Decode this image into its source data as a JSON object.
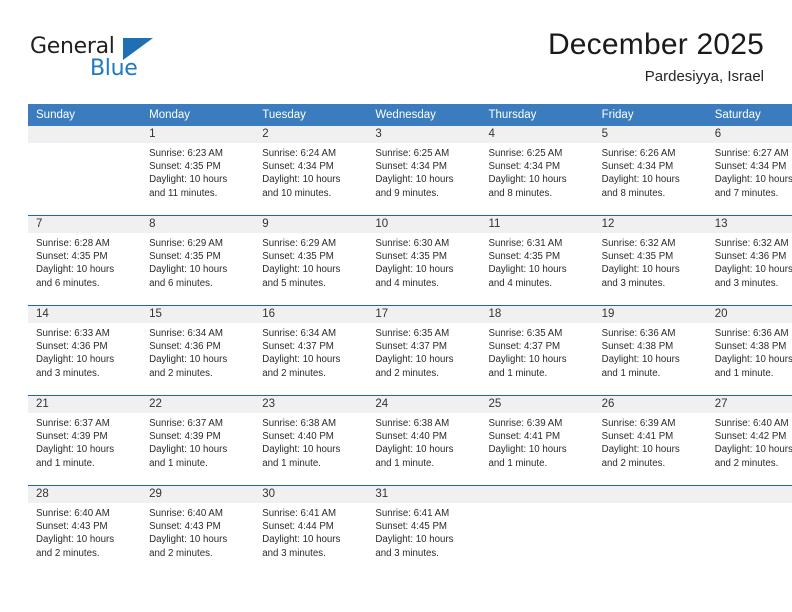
{
  "logo": {
    "text_top": "General",
    "text_bottom": "Blue"
  },
  "header": {
    "title": "December 2025",
    "location": "Pardesiyya, Israel"
  },
  "colors": {
    "header_blue": "#3a7cbe",
    "row_divider_blue": "#1c68ab",
    "daynum_band": "#f0f0f0",
    "logo_blue": "#1f7ac0"
  },
  "weekday_headers": [
    "Sunday",
    "Monday",
    "Tuesday",
    "Wednesday",
    "Thursday",
    "Friday",
    "Saturday"
  ],
  "weeks": [
    [
      {
        "day": "",
        "blank": true,
        "sunrise": "",
        "sunset": "",
        "daylight1": "",
        "daylight2": ""
      },
      {
        "day": "1",
        "sunrise": "Sunrise: 6:23 AM",
        "sunset": "Sunset: 4:35 PM",
        "daylight1": "Daylight: 10 hours",
        "daylight2": "and 11 minutes."
      },
      {
        "day": "2",
        "sunrise": "Sunrise: 6:24 AM",
        "sunset": "Sunset: 4:34 PM",
        "daylight1": "Daylight: 10 hours",
        "daylight2": "and 10 minutes."
      },
      {
        "day": "3",
        "sunrise": "Sunrise: 6:25 AM",
        "sunset": "Sunset: 4:34 PM",
        "daylight1": "Daylight: 10 hours",
        "daylight2": "and 9 minutes."
      },
      {
        "day": "4",
        "sunrise": "Sunrise: 6:25 AM",
        "sunset": "Sunset: 4:34 PM",
        "daylight1": "Daylight: 10 hours",
        "daylight2": "and 8 minutes."
      },
      {
        "day": "5",
        "sunrise": "Sunrise: 6:26 AM",
        "sunset": "Sunset: 4:34 PM",
        "daylight1": "Daylight: 10 hours",
        "daylight2": "and 8 minutes."
      },
      {
        "day": "6",
        "sunrise": "Sunrise: 6:27 AM",
        "sunset": "Sunset: 4:34 PM",
        "daylight1": "Daylight: 10 hours",
        "daylight2": "and 7 minutes."
      }
    ],
    [
      {
        "day": "7",
        "sunrise": "Sunrise: 6:28 AM",
        "sunset": "Sunset: 4:35 PM",
        "daylight1": "Daylight: 10 hours",
        "daylight2": "and 6 minutes."
      },
      {
        "day": "8",
        "sunrise": "Sunrise: 6:29 AM",
        "sunset": "Sunset: 4:35 PM",
        "daylight1": "Daylight: 10 hours",
        "daylight2": "and 6 minutes."
      },
      {
        "day": "9",
        "sunrise": "Sunrise: 6:29 AM",
        "sunset": "Sunset: 4:35 PM",
        "daylight1": "Daylight: 10 hours",
        "daylight2": "and 5 minutes."
      },
      {
        "day": "10",
        "sunrise": "Sunrise: 6:30 AM",
        "sunset": "Sunset: 4:35 PM",
        "daylight1": "Daylight: 10 hours",
        "daylight2": "and 4 minutes."
      },
      {
        "day": "11",
        "sunrise": "Sunrise: 6:31 AM",
        "sunset": "Sunset: 4:35 PM",
        "daylight1": "Daylight: 10 hours",
        "daylight2": "and 4 minutes."
      },
      {
        "day": "12",
        "sunrise": "Sunrise: 6:32 AM",
        "sunset": "Sunset: 4:35 PM",
        "daylight1": "Daylight: 10 hours",
        "daylight2": "and 3 minutes."
      },
      {
        "day": "13",
        "sunrise": "Sunrise: 6:32 AM",
        "sunset": "Sunset: 4:36 PM",
        "daylight1": "Daylight: 10 hours",
        "daylight2": "and 3 minutes."
      }
    ],
    [
      {
        "day": "14",
        "sunrise": "Sunrise: 6:33 AM",
        "sunset": "Sunset: 4:36 PM",
        "daylight1": "Daylight: 10 hours",
        "daylight2": "and 3 minutes."
      },
      {
        "day": "15",
        "sunrise": "Sunrise: 6:34 AM",
        "sunset": "Sunset: 4:36 PM",
        "daylight1": "Daylight: 10 hours",
        "daylight2": "and 2 minutes."
      },
      {
        "day": "16",
        "sunrise": "Sunrise: 6:34 AM",
        "sunset": "Sunset: 4:37 PM",
        "daylight1": "Daylight: 10 hours",
        "daylight2": "and 2 minutes."
      },
      {
        "day": "17",
        "sunrise": "Sunrise: 6:35 AM",
        "sunset": "Sunset: 4:37 PM",
        "daylight1": "Daylight: 10 hours",
        "daylight2": "and 2 minutes."
      },
      {
        "day": "18",
        "sunrise": "Sunrise: 6:35 AM",
        "sunset": "Sunset: 4:37 PM",
        "daylight1": "Daylight: 10 hours",
        "daylight2": "and 1 minute."
      },
      {
        "day": "19",
        "sunrise": "Sunrise: 6:36 AM",
        "sunset": "Sunset: 4:38 PM",
        "daylight1": "Daylight: 10 hours",
        "daylight2": "and 1 minute."
      },
      {
        "day": "20",
        "sunrise": "Sunrise: 6:36 AM",
        "sunset": "Sunset: 4:38 PM",
        "daylight1": "Daylight: 10 hours",
        "daylight2": "and 1 minute."
      }
    ],
    [
      {
        "day": "21",
        "sunrise": "Sunrise: 6:37 AM",
        "sunset": "Sunset: 4:39 PM",
        "daylight1": "Daylight: 10 hours",
        "daylight2": "and 1 minute."
      },
      {
        "day": "22",
        "sunrise": "Sunrise: 6:37 AM",
        "sunset": "Sunset: 4:39 PM",
        "daylight1": "Daylight: 10 hours",
        "daylight2": "and 1 minute."
      },
      {
        "day": "23",
        "sunrise": "Sunrise: 6:38 AM",
        "sunset": "Sunset: 4:40 PM",
        "daylight1": "Daylight: 10 hours",
        "daylight2": "and 1 minute."
      },
      {
        "day": "24",
        "sunrise": "Sunrise: 6:38 AM",
        "sunset": "Sunset: 4:40 PM",
        "daylight1": "Daylight: 10 hours",
        "daylight2": "and 1 minute."
      },
      {
        "day": "25",
        "sunrise": "Sunrise: 6:39 AM",
        "sunset": "Sunset: 4:41 PM",
        "daylight1": "Daylight: 10 hours",
        "daylight2": "and 1 minute."
      },
      {
        "day": "26",
        "sunrise": "Sunrise: 6:39 AM",
        "sunset": "Sunset: 4:41 PM",
        "daylight1": "Daylight: 10 hours",
        "daylight2": "and 2 minutes."
      },
      {
        "day": "27",
        "sunrise": "Sunrise: 6:40 AM",
        "sunset": "Sunset: 4:42 PM",
        "daylight1": "Daylight: 10 hours",
        "daylight2": "and 2 minutes."
      }
    ],
    [
      {
        "day": "28",
        "sunrise": "Sunrise: 6:40 AM",
        "sunset": "Sunset: 4:43 PM",
        "daylight1": "Daylight: 10 hours",
        "daylight2": "and 2 minutes."
      },
      {
        "day": "29",
        "sunrise": "Sunrise: 6:40 AM",
        "sunset": "Sunset: 4:43 PM",
        "daylight1": "Daylight: 10 hours",
        "daylight2": "and 2 minutes."
      },
      {
        "day": "30",
        "sunrise": "Sunrise: 6:41 AM",
        "sunset": "Sunset: 4:44 PM",
        "daylight1": "Daylight: 10 hours",
        "daylight2": "and 3 minutes."
      },
      {
        "day": "31",
        "sunrise": "Sunrise: 6:41 AM",
        "sunset": "Sunset: 4:45 PM",
        "daylight1": "Daylight: 10 hours",
        "daylight2": "and 3 minutes."
      },
      {
        "day": "",
        "blank": true,
        "sunrise": "",
        "sunset": "",
        "daylight1": "",
        "daylight2": ""
      },
      {
        "day": "",
        "blank": true,
        "sunrise": "",
        "sunset": "",
        "daylight1": "",
        "daylight2": ""
      },
      {
        "day": "",
        "blank": true,
        "sunrise": "",
        "sunset": "",
        "daylight1": "",
        "daylight2": ""
      }
    ]
  ]
}
